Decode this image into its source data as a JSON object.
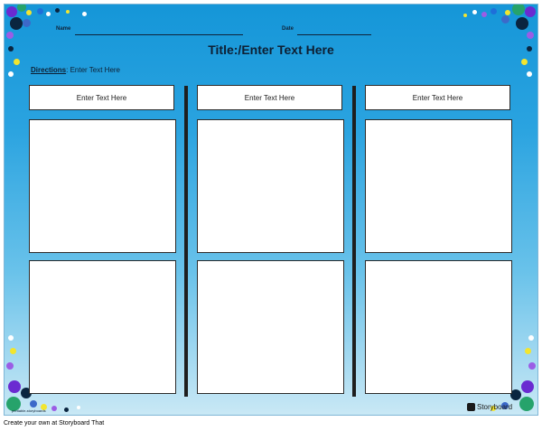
{
  "header": {
    "name_label": "Name",
    "date_label": "Date"
  },
  "worksheet": {
    "title": "Title:/Enter Text Here",
    "directions_label": "Directions",
    "directions_text": ": Enter Text Here",
    "columns": [
      {
        "header": "Enter Text Here"
      },
      {
        "header": "Enter Text Here"
      },
      {
        "header": "Enter Text Here"
      }
    ]
  },
  "branding": {
    "left_logo": "printable-storyboards",
    "right_logo": "Storyboard"
  },
  "footer": {
    "text": "Create your own at Storyboard That"
  }
}
